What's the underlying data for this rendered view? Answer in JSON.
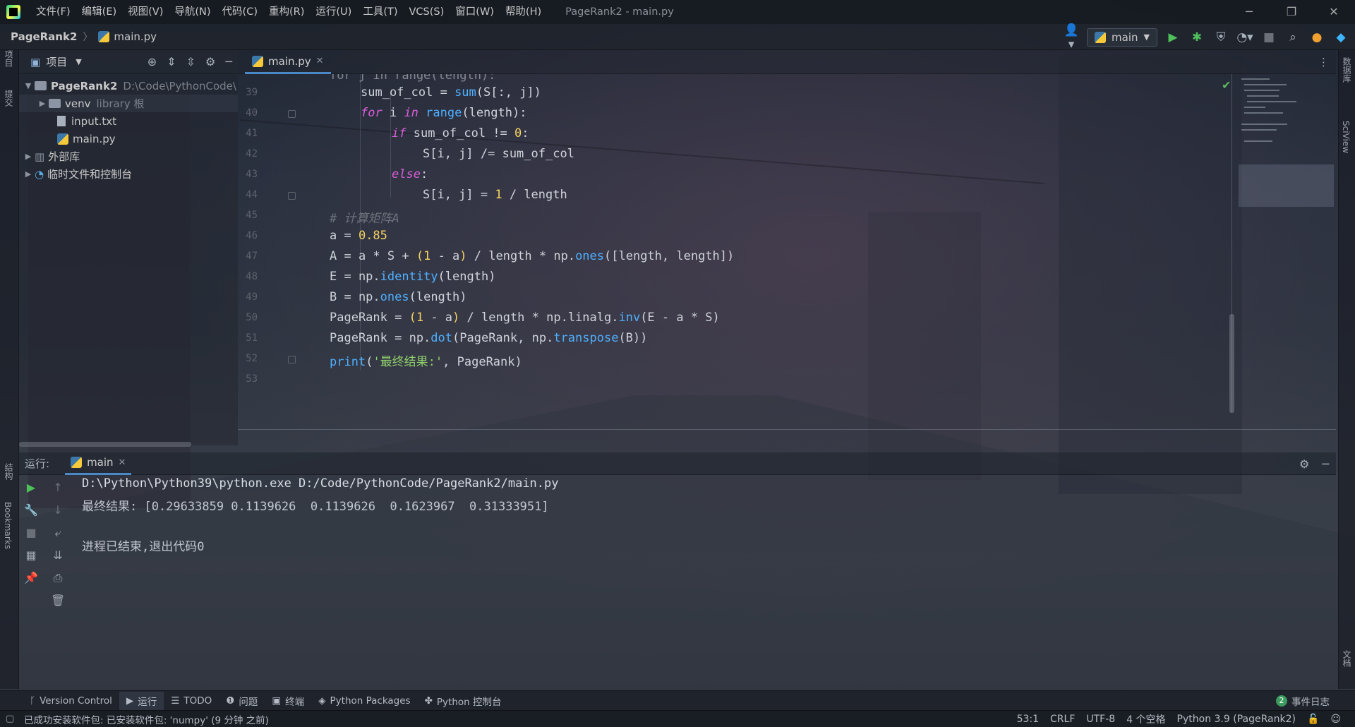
{
  "titlebar": {
    "menu": [
      "文件(F)",
      "编辑(E)",
      "视图(V)",
      "导航(N)",
      "代码(C)",
      "重构(R)",
      "运行(U)",
      "工具(T)",
      "VCS(S)",
      "窗口(W)",
      "帮助(H)"
    ],
    "window_title": "PageRank2 - main.py"
  },
  "navbar": {
    "project": "PageRank2",
    "file": "main.py",
    "run_config": "main"
  },
  "left_stripe": {
    "project": "项目",
    "commit": "提交",
    "structure": "结构",
    "bookmarks": "Bookmarks"
  },
  "right_stripe": {
    "database": "数据库",
    "sciview": "SciView",
    "docs": "文档"
  },
  "project_panel": {
    "title": "项目",
    "tree": [
      {
        "name": "PageRank2",
        "hint": "D:\\Code\\PythonCode\\"
      },
      {
        "name": "venv",
        "hint": "library 根"
      },
      {
        "name": "input.txt",
        "hint": ""
      },
      {
        "name": "main.py",
        "hint": ""
      },
      {
        "name": "外部库",
        "hint": ""
      },
      {
        "name": "临时文件和控制台",
        "hint": ""
      }
    ]
  },
  "editor": {
    "tab": "main.py",
    "line_numbers": [
      "39",
      "40",
      "41",
      "42",
      "43",
      "44",
      "45",
      "46",
      "47",
      "48",
      "49",
      "50",
      "51",
      "52",
      "53"
    ],
    "top_partial": "for j in range(length):",
    "lines": {
      "l39": {
        "a": "sum_of_col = ",
        "b": "sum",
        "c": "(S[:, j])"
      },
      "l40": {
        "kw": "for",
        "a": " i ",
        "kw2": "in",
        "fn": " range",
        "b": "(length):"
      },
      "l41": {
        "kw": "if",
        "a": " sum_of_col != ",
        "n": "0",
        "b": ":"
      },
      "l42": {
        "a": "S[i, j] /= sum_of_col"
      },
      "l43": {
        "kw": "else",
        "a": ":"
      },
      "l44": {
        "a": "S[i, j] = ",
        "n": "1",
        "b": " / length"
      },
      "l45": {
        "c": "# 计算矩阵A"
      },
      "l46": {
        "a": "a = ",
        "n": "0.85"
      },
      "l47": {
        "a": "A = a * S + ",
        "p1": "(",
        "n": "1",
        "b": " - a",
        "p2": ")",
        "c": " / length * np.",
        "fn": "ones",
        "d": "([length, length])"
      },
      "l48": {
        "a": "E = np.",
        "fn": "identity",
        "b": "(length)"
      },
      "l49": {
        "a": "B = np.",
        "fn": "ones",
        "b": "(length)"
      },
      "l50": {
        "a": "PageRank = ",
        "p1": "(",
        "n": "1",
        "b": " - a",
        "p2": ")",
        "c": " / length * np.linalg.",
        "fn": "inv",
        "d": "(E - a * S)"
      },
      "l51": {
        "a": "PageRank = np.",
        "fn": "dot",
        "b": "(PageRank, np.",
        "fn2": "transpose",
        "c": "(B))"
      },
      "l52": {
        "fn": "print",
        "a": "(",
        "s": "'最终结果:'",
        "b": ", PageRank)"
      }
    }
  },
  "run_panel": {
    "label": "运行:",
    "tab": "main",
    "output": [
      "D:\\Python\\Python39\\python.exe D:/Code/PythonCode/PageRank2/main.py",
      "最终结果: [0.29633859 0.1139626  0.1139626  0.1623967  0.31333951]",
      "进程已结束,退出代码0"
    ]
  },
  "bottom_tools": {
    "items": [
      "Version Control",
      "运行",
      "TODO",
      "问题",
      "终端",
      "Python Packages",
      "Python 控制台"
    ],
    "event_log": "事件日志",
    "event_count": "2"
  },
  "statusbar": {
    "message": "已成功安装软件包: 已安装软件包: 'numpy' (9 分钟 之前)",
    "position": "53:1",
    "line_sep": "CRLF",
    "encoding": "UTF-8",
    "indent": "4 个空格",
    "interpreter": "Python 3.9 (PageRank2)"
  },
  "colors": {
    "keyword": "#d95ed9",
    "number": "#f5d361",
    "function": "#4fb0ff",
    "string": "#8fcf6b",
    "accent": "#4a88c7"
  }
}
